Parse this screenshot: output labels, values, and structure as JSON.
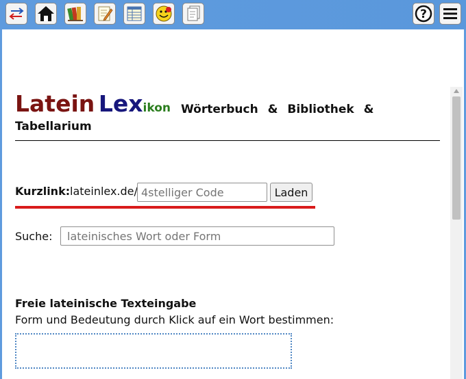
{
  "toolbar": {
    "buttons": [
      {
        "icon": "swap-arrows-icon"
      },
      {
        "icon": "home-icon"
      },
      {
        "icon": "books-icon"
      },
      {
        "icon": "edit-pencil-icon"
      },
      {
        "icon": "table-icon"
      },
      {
        "icon": "quiz-smiley-icon"
      },
      {
        "icon": "documents-icon"
      },
      {
        "icon": "help-icon"
      },
      {
        "icon": "menu-icon"
      }
    ],
    "help_label": "?"
  },
  "brand": {
    "part1": "Latein",
    "part2": "Lex",
    "part3": "ikon"
  },
  "tagline": "Wörterbuch & Bibliothek & Tabellarium",
  "kurzlink": {
    "label": "Kurzlink:",
    "prefix": "lateinlex.de/",
    "placeholder": "4stelliger Code",
    "button": "Laden"
  },
  "suche": {
    "label": "Suche:",
    "placeholder": "lateinisches Wort oder Form"
  },
  "freitext": {
    "title": "Freie lateinische Texteingabe",
    "subtitle": "Form und Bedeutung durch Klick auf ein Wort bestimmen:"
  },
  "colors": {
    "toolbar": "#5f9bde",
    "brand_latein": "#7a1412",
    "brand_lex": "#17177c",
    "brand_ikon": "#2a7d1d",
    "accent_red": "#d91b1b"
  }
}
